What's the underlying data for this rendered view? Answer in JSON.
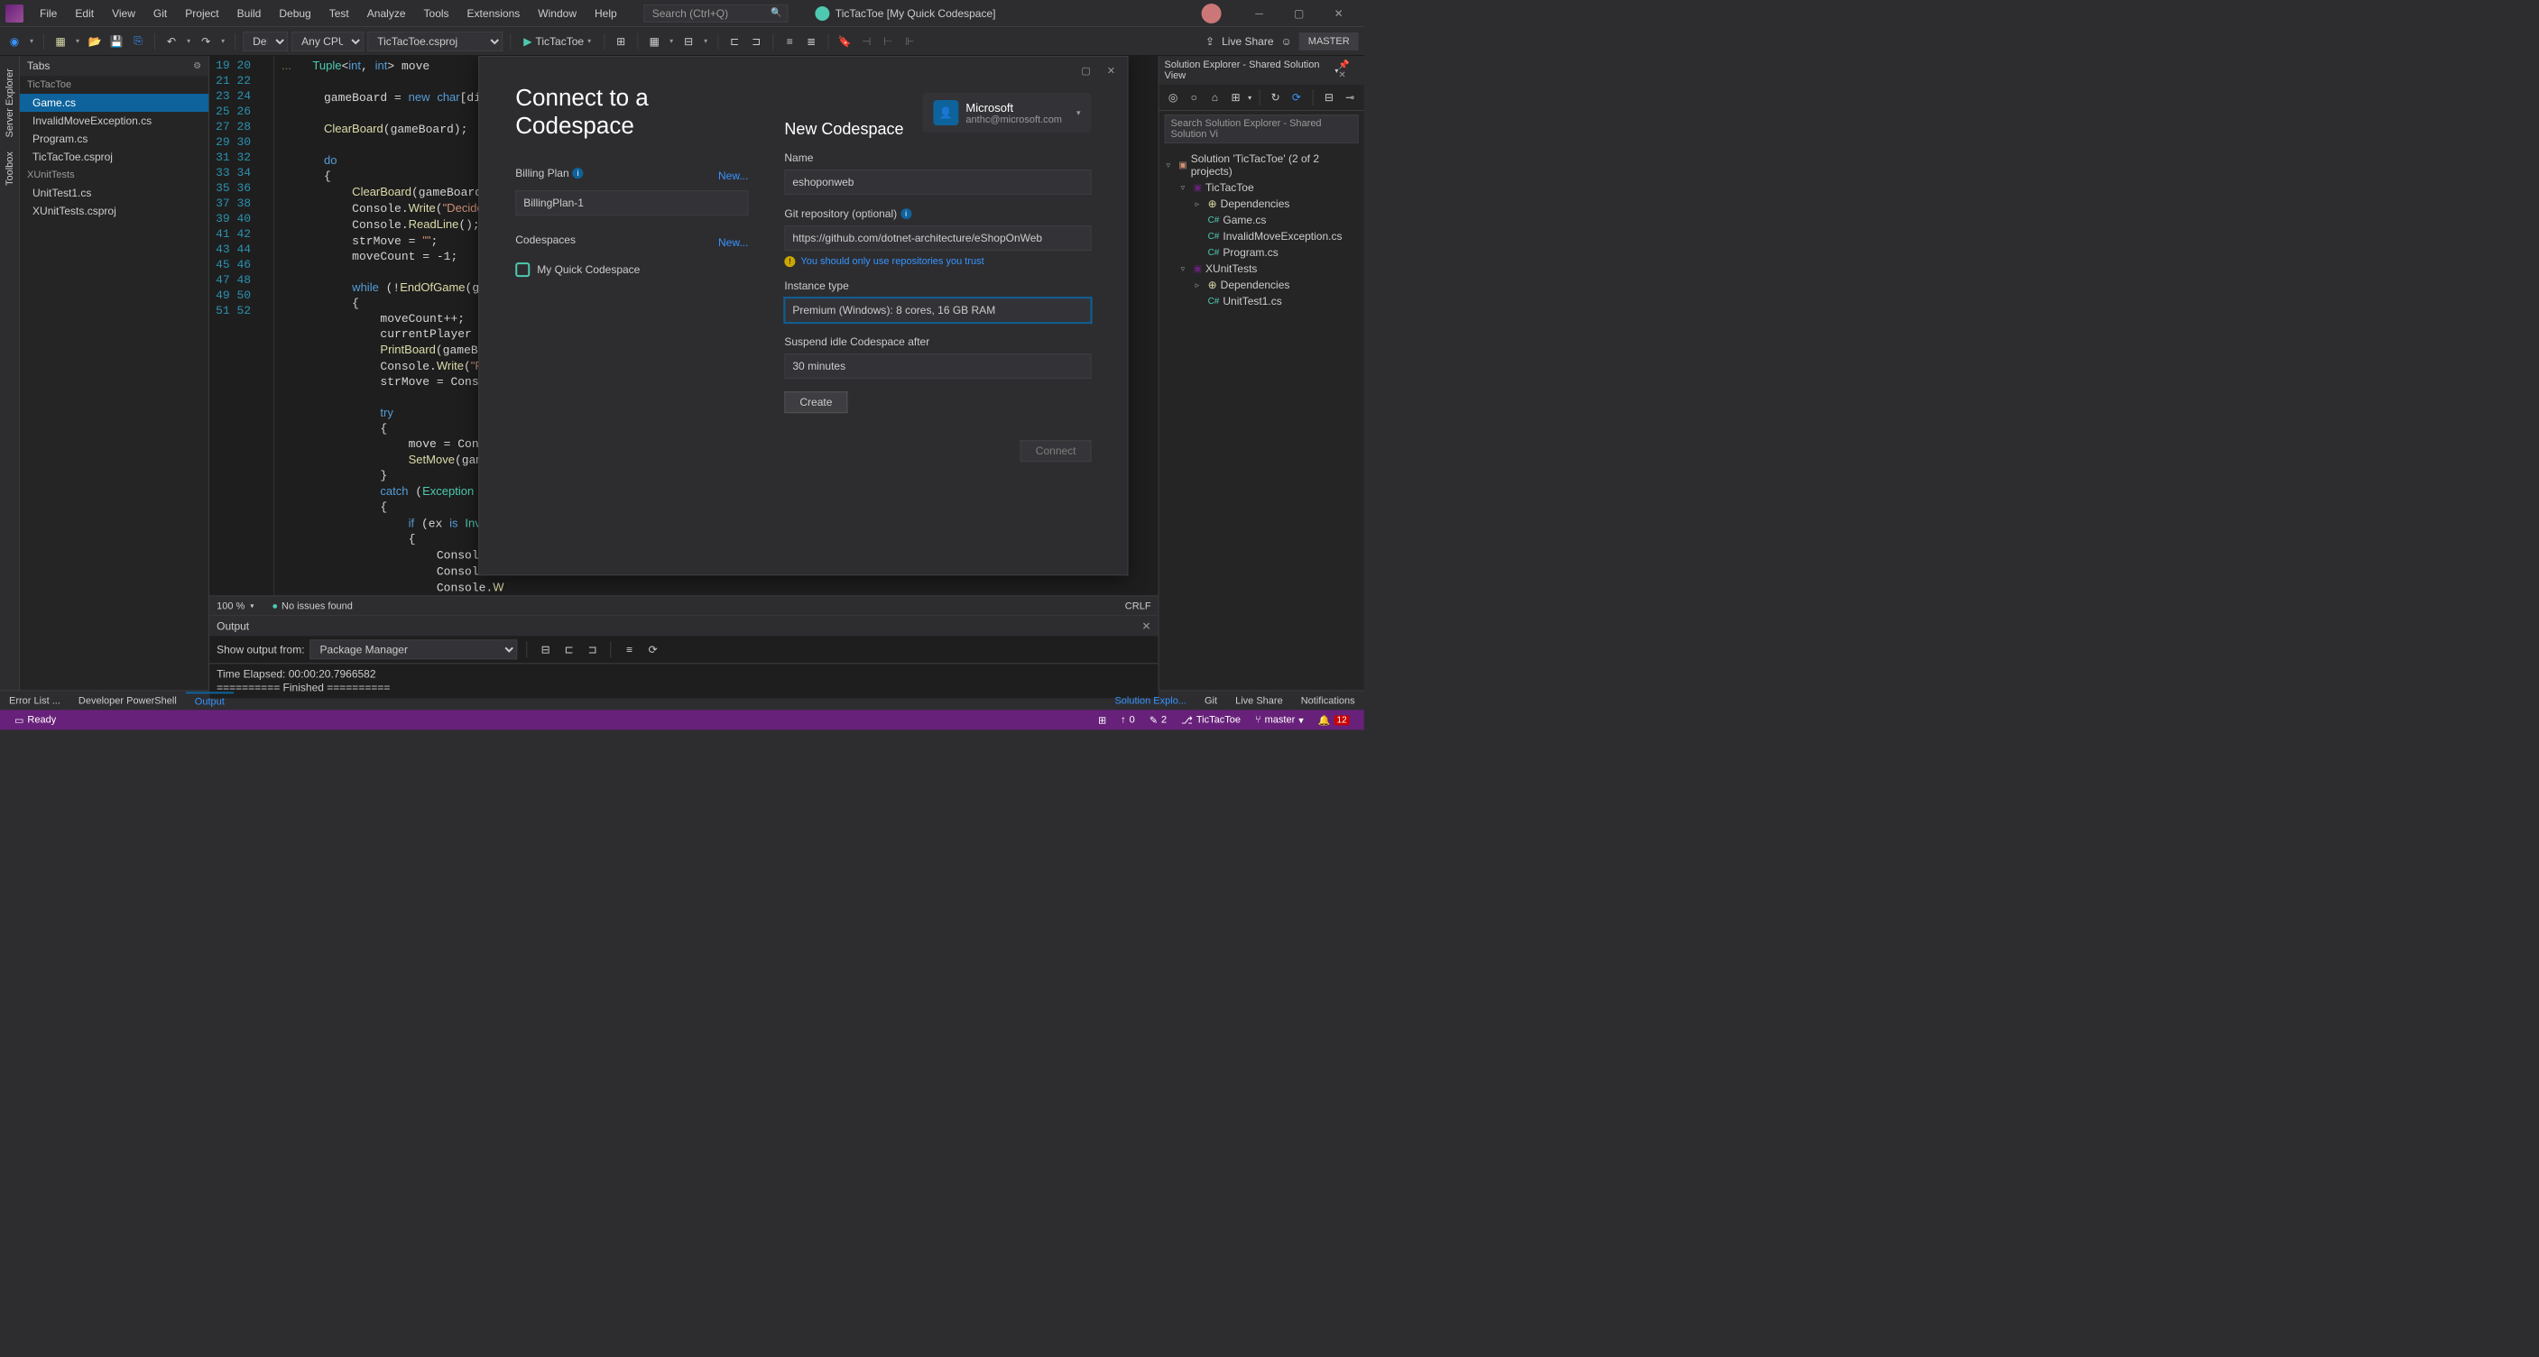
{
  "menu": {
    "items": [
      "File",
      "Edit",
      "View",
      "Git",
      "Project",
      "Build",
      "Debug",
      "Test",
      "Analyze",
      "Tools",
      "Extensions",
      "Window",
      "Help"
    ]
  },
  "search": {
    "placeholder": "Search (Ctrl+Q)"
  },
  "title": {
    "app": "TicTacToe [My Quick Codespace]"
  },
  "toolbar": {
    "config": "Debug",
    "platform": "Any CPU",
    "project": "TicTacToe.csproj",
    "start": "TicTacToe",
    "liveshare": "Live Share",
    "master": "MASTER"
  },
  "leftRail": [
    "Server Explorer",
    "Toolbox"
  ],
  "tabsPanel": {
    "header": "Tabs",
    "group1": "TicTacToe",
    "items1": [
      "Game.cs",
      "InvalidMoveException.cs",
      "Program.cs",
      "TicTacToe.csproj"
    ],
    "group2": "XUnitTests",
    "items2": [
      "UnitTest1.cs",
      "XUnitTests.csproj"
    ]
  },
  "editor": {
    "zoom": "100 %",
    "issues": "No issues found",
    "crlf": "CRLF",
    "lines": [
      19,
      20,
      21,
      22,
      23,
      24,
      25,
      26,
      27,
      28,
      29,
      30,
      31,
      32,
      33,
      34,
      35,
      36,
      37,
      38,
      39,
      40,
      41,
      42,
      43,
      44,
      45,
      46,
      47,
      48,
      49,
      50,
      51,
      52
    ]
  },
  "modal": {
    "title": "Connect to a Codespace",
    "billing_label": "Billing Plan",
    "new": "New...",
    "billing_value": "BillingPlan-1",
    "codespaces_label": "Codespaces",
    "cs_item": "My Quick Codespace",
    "account_name": "Microsoft",
    "account_email": "anthc@microsoft.com",
    "new_title": "New Codespace",
    "name_label": "Name",
    "name_value": "eshoponweb",
    "git_label": "Git repository (optional)",
    "git_value": "https://github.com/dotnet-architecture/eShopOnWeb",
    "warn": "You should only use repositories you trust",
    "instance_label": "Instance type",
    "instance_value": "Premium (Windows): 8 cores, 16 GB RAM",
    "suspend_label": "Suspend idle Codespace after",
    "suspend_value": "30 minutes",
    "create": "Create",
    "connect": "Connect"
  },
  "solexp": {
    "header": "Solution Explorer - Shared Solution View",
    "search": "Search Solution Explorer - Shared Solution Vi",
    "sln": "Solution 'TicTacToe' (2 of 2 projects)",
    "p1": "TicTacToe",
    "p1dep": "Dependencies",
    "p1files": [
      "Game.cs",
      "InvalidMoveException.cs",
      "Program.cs"
    ],
    "p2": "XUnitTests",
    "p2dep": "Dependencies",
    "p2files": [
      "UnitTest1.cs"
    ]
  },
  "output": {
    "header": "Output",
    "from_label": "Show output from:",
    "from_value": "Package Manager",
    "line1": "Time Elapsed: 00:00:20.7966582",
    "line2": "========== Finished =========="
  },
  "bottomTabs": {
    "errorlist": "Error List ...",
    "devps": "Developer PowerShell",
    "output": "Output",
    "solexp": "Solution Explo...",
    "git": "Git",
    "liveshare": "Live Share",
    "notif": "Notifications"
  },
  "statusBar": {
    "ready": "Ready",
    "up": "0",
    "edit": "2",
    "repo": "TicTacToe",
    "branch": "master",
    "bell": "12"
  }
}
